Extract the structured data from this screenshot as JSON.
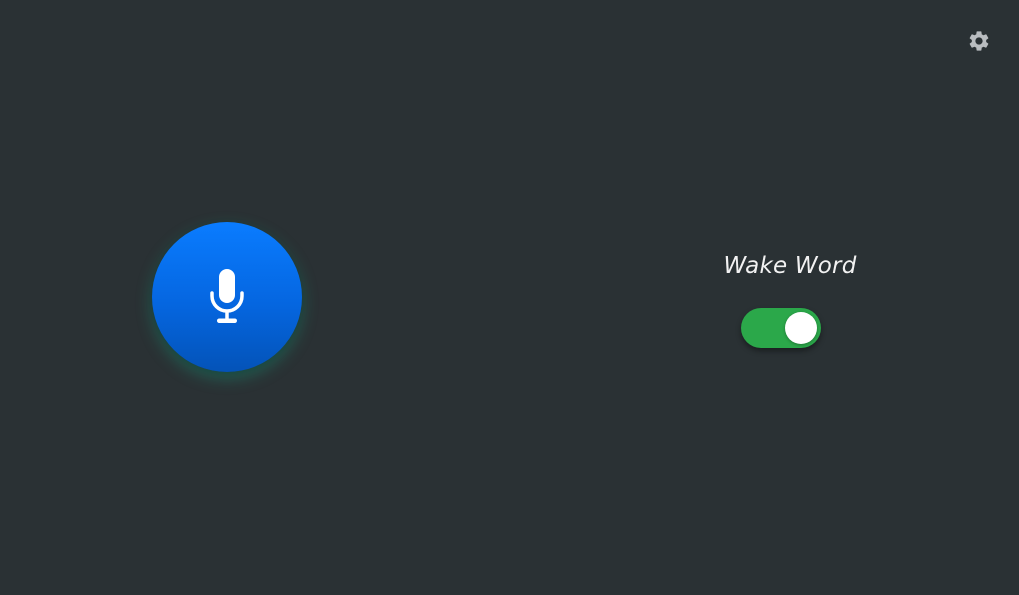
{
  "header": {
    "settings_icon": "gear-icon"
  },
  "mic": {
    "icon": "microphone-icon",
    "color": "#0a7cff"
  },
  "wake_word": {
    "label": "Wake Word",
    "enabled": true,
    "toggle_color": "#2ba84a"
  },
  "colors": {
    "background": "#2a3134",
    "settings_icon": "#b9bdc0"
  }
}
